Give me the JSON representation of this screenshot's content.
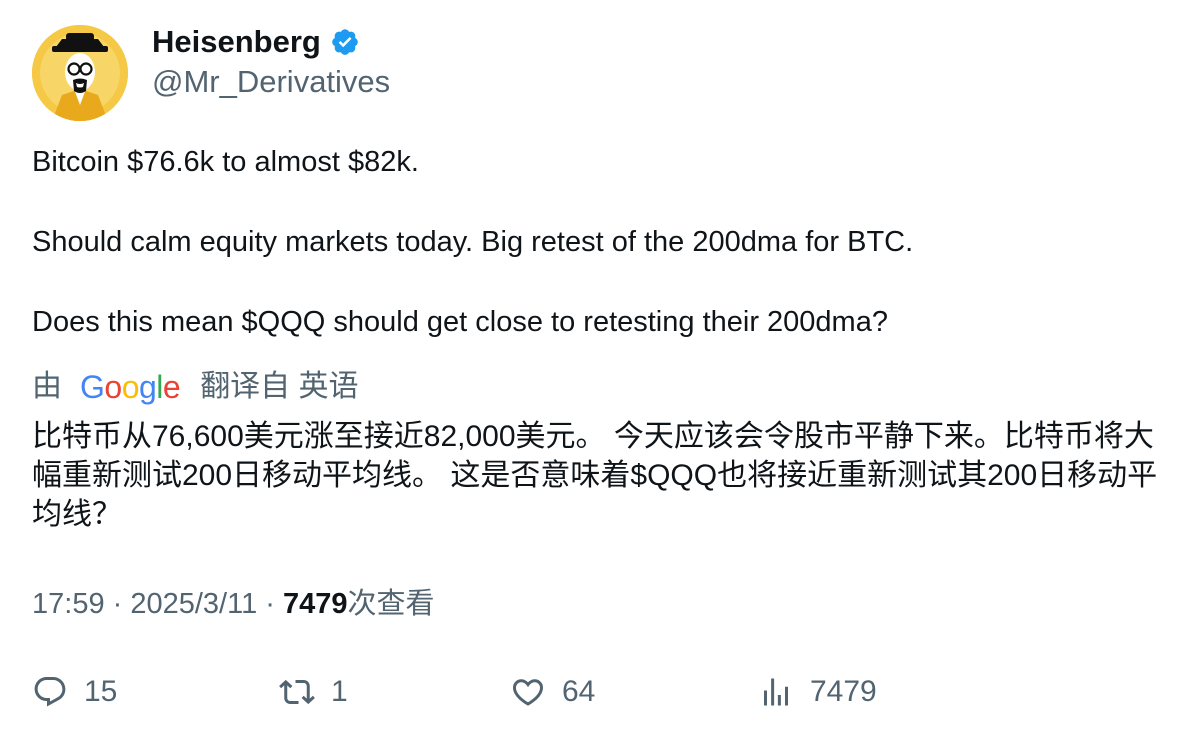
{
  "author": {
    "display_name": "Heisenberg",
    "handle": "@Mr_Derivatives",
    "verified": true,
    "verified_color": "#1d9bf0"
  },
  "tweet": {
    "paragraphs": [
      "Bitcoin $76.6k to almost $82k.",
      "Should calm equity markets today. Big retest of the 200dma for BTC.",
      "Does this mean $QQQ should get close to retesting their 200dma?"
    ]
  },
  "translation": {
    "prefix": "由",
    "provider": "Google",
    "suffix": "翻译自 英语",
    "text": "比特币从76,600美元涨至接近82,000美元。 今天应该会令股市平静下来。比特币将大幅重新测试200日移动平均线。 这是否意味着$QQQ也将接近重新测试其200日移动平均线？"
  },
  "meta": {
    "time": "17:59",
    "sep1": " · ",
    "date": "2025/3/11",
    "sep2": " · ",
    "views_count": "7479",
    "views_label": "次查看"
  },
  "actions": {
    "replies": "15",
    "retweets": "1",
    "likes": "64",
    "views": "7479"
  },
  "colors": {
    "text_primary": "#0f1419",
    "text_secondary": "#536471",
    "avatar_bg": "#f6c94a"
  }
}
